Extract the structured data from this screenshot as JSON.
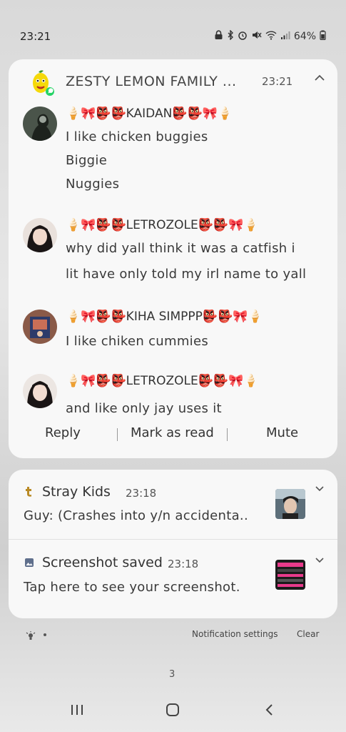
{
  "status_bar": {
    "time": "23:21",
    "battery": "64%"
  },
  "group_notification": {
    "title": "ZESTY LEMON FAMILY ...",
    "time": "23:21",
    "messages": [
      {
        "sender": "🍦🎀👺👺KAIDAN👺👺🎀🍦",
        "lines": [
          "I like chicken buggies",
          "Biggie",
          "Nuggies"
        ]
      },
      {
        "sender": "🍦🎀👺👺LETROZOLE👺👺🎀🍦",
        "lines": [
          "why did yall think it was a catfish i",
          "lit have only told my irl name to yall"
        ]
      },
      {
        "sender": "🍦🎀👺👺KIHA SIMPPP👺👺🎀🍦",
        "lines": [
          "I like chiken cummies"
        ]
      },
      {
        "sender": "🍦🎀👺👺LETROZOLE👺👺🎀🍦",
        "lines": [
          "and like only jay uses it"
        ]
      }
    ],
    "actions": {
      "reply": "Reply",
      "mark_as_read": "Mark as read",
      "mute": "Mute"
    }
  },
  "stray_kids_notification": {
    "title": "Stray Kids",
    "time": "23:18",
    "text": "Guy: (Crashes into y/n accidenta.."
  },
  "screenshot_notification": {
    "title": "Screenshot saved",
    "time": "23:18",
    "text": "Tap here to see your screenshot."
  },
  "footer": {
    "notification_settings": "Notification settings",
    "clear": "Clear"
  },
  "page_indicator": "3",
  "icons": {
    "app": "whatsapp-lemon-icon",
    "collapse": "chevron-up-icon",
    "expand": "chevron-down-icon",
    "tumblr": "tumblr-icon",
    "gallery": "gallery-icon",
    "nav_recents": "recents-icon",
    "nav_home": "home-icon",
    "nav_back": "back-icon"
  },
  "colors": {
    "card": "#f8f8f8",
    "background": "#dcdcdc"
  }
}
